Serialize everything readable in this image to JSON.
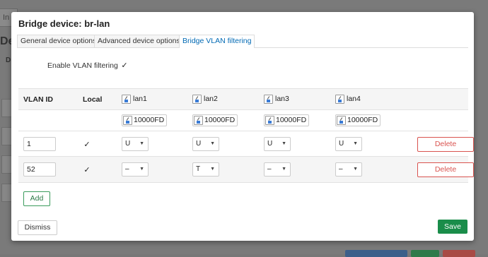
{
  "background": {
    "tab_label": "In",
    "heading": "De",
    "subheading": "D"
  },
  "modal": {
    "title": "Bridge device: br-lan",
    "tabs": [
      {
        "label": "General device options",
        "active": false
      },
      {
        "label": "Advanced device options",
        "active": false
      },
      {
        "label": "Bridge VLAN filtering",
        "active": true
      }
    ],
    "enable_vlan_filtering": {
      "label": "Enable VLAN filtering",
      "checked": true,
      "glyph": "✓"
    },
    "table": {
      "headers": {
        "vlan_id": "VLAN ID",
        "local": "Local"
      },
      "ports": [
        {
          "name": "lan1",
          "speed": "10000FD"
        },
        {
          "name": "lan2",
          "speed": "10000FD"
        },
        {
          "name": "lan3",
          "speed": "10000FD"
        },
        {
          "name": "lan4",
          "speed": "10000FD"
        }
      ],
      "rows": [
        {
          "vlan_id": "1",
          "local": true,
          "ports": [
            "U",
            "U",
            "U",
            "U"
          ],
          "delete_label": "Delete"
        },
        {
          "vlan_id": "52",
          "local": true,
          "ports": [
            "–",
            "T",
            "–",
            "–"
          ],
          "delete_label": "Delete"
        }
      ]
    },
    "add_label": "Add",
    "dismiss_label": "Dismiss",
    "save_label": "Save",
    "caret_glyph": "▼"
  },
  "colors": {
    "accent_blue": "#0069b4",
    "delete_red": "#d9534f",
    "save_green": "#1a8d4a",
    "add_green": "#3a9b5c"
  }
}
